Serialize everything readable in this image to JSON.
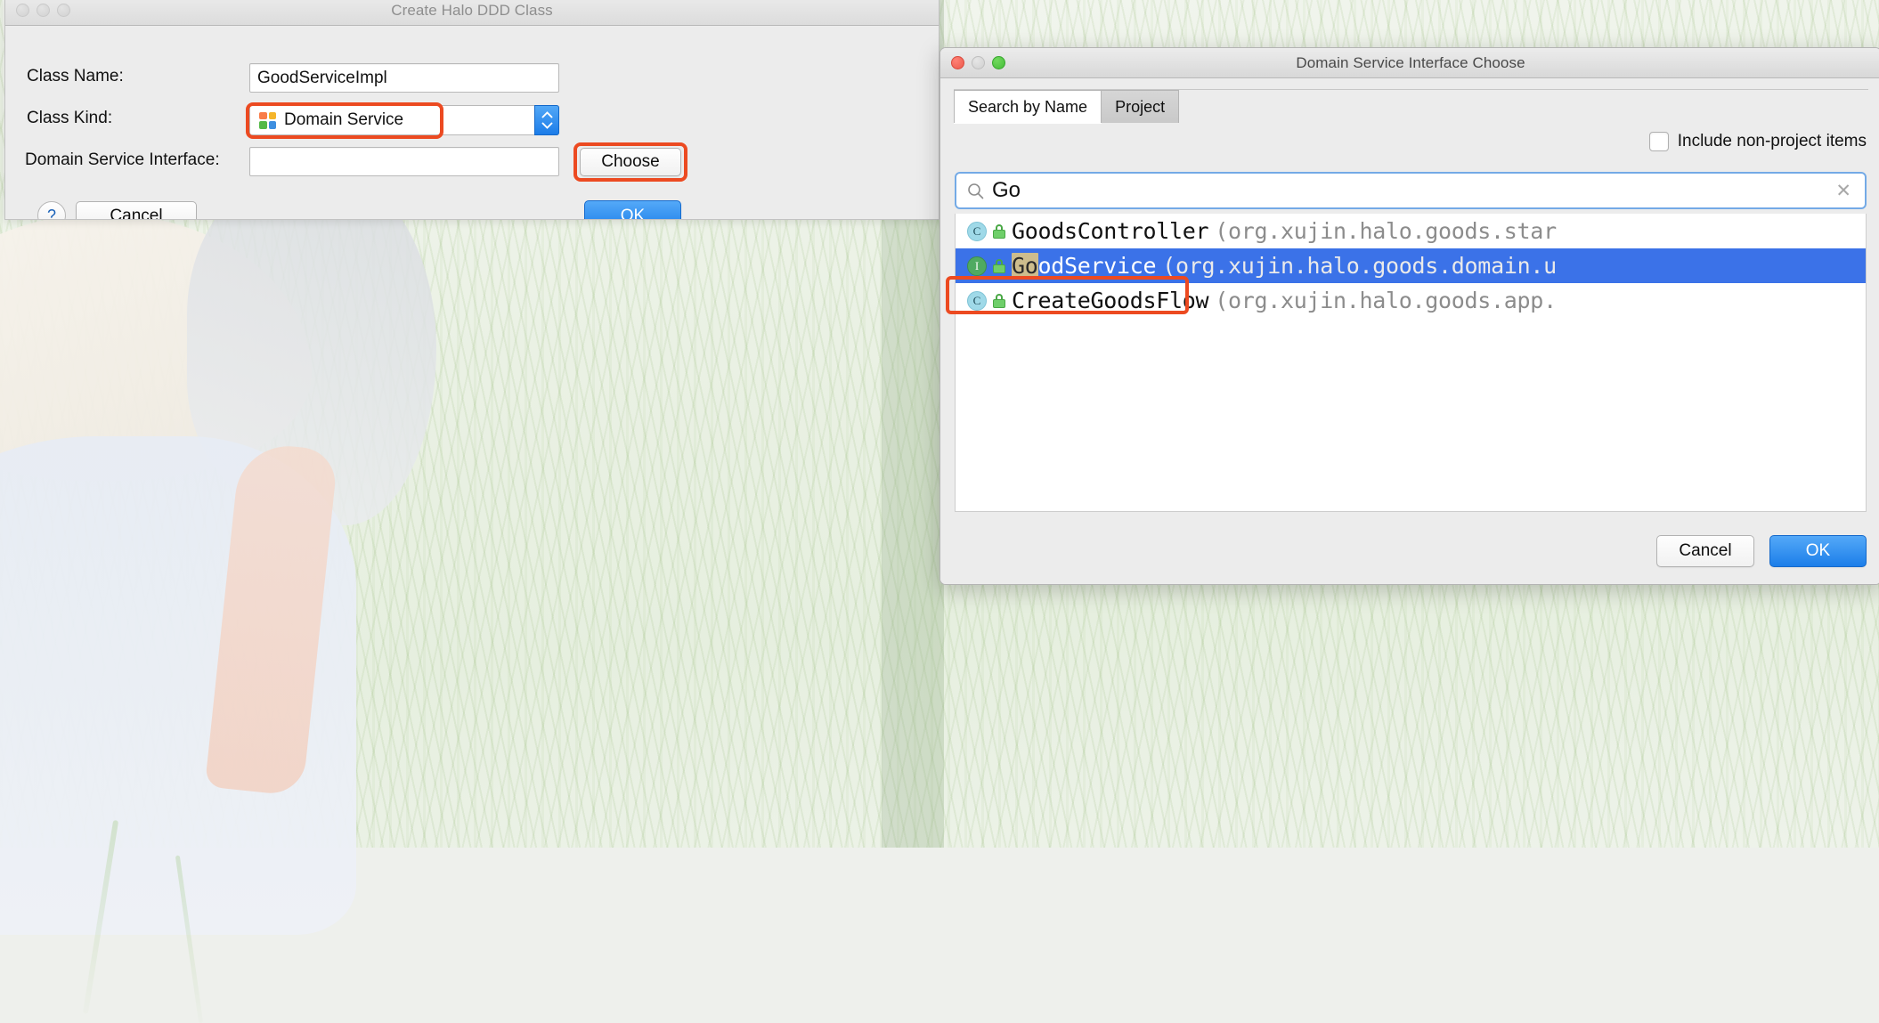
{
  "desktop": {
    "note": "blurred light background photo of a figure in grass"
  },
  "left_dialog": {
    "title": "Create Halo DDD Class",
    "traffic_lights": [
      "close-inactive",
      "minimize-inactive",
      "maximize-inactive"
    ],
    "fields": {
      "class_name_label": "Class   Name:",
      "class_name_value": "GoodServiceImpl",
      "class_name_placeholder": "",
      "class_kind_label": "Class   Kind:",
      "class_kind_value": "Domain Service",
      "class_kind_icon": "module-squares-icon",
      "domain_service_interface_label": "Domain Service Interface:",
      "domain_service_interface_value": "",
      "domain_service_interface_placeholder": ""
    },
    "buttons": {
      "choose": "Choose",
      "help": "?",
      "cancel": "Cancel",
      "ok": "OK"
    },
    "highlights": [
      "class-kind-combo",
      "choose-button"
    ]
  },
  "right_dialog": {
    "title": "Domain Service Interface Choose",
    "traffic_lights": [
      "close-red",
      "minimize-gray",
      "maximize-green"
    ],
    "tabs": [
      {
        "label": "Search by Name",
        "selected": true
      },
      {
        "label": "Project",
        "selected": false
      }
    ],
    "include_non_project": {
      "label": "Include non-project items",
      "checked": false
    },
    "search": {
      "icon": "search-icon",
      "value": "Go",
      "placeholder": "",
      "clear_icon": "clear-x-icon"
    },
    "results": [
      {
        "type_badge": "C",
        "type_kind": "class",
        "visibility_icon": "public-lock-icon",
        "name": "GoodsController",
        "match_prefix": "",
        "package": "(org.xujin.halo.goods.star",
        "selected": false
      },
      {
        "type_badge": "I",
        "type_kind": "interface",
        "visibility_icon": "public-lock-icon",
        "name": "GoodService",
        "match_prefix": "Go",
        "package": "(org.xujin.halo.goods.domain.u",
        "selected": true
      },
      {
        "type_badge": "C",
        "type_kind": "class",
        "visibility_icon": "public-lock-icon",
        "name": "CreateGoodsFlow",
        "match_prefix": "",
        "package": "(org.xujin.halo.goods.app.",
        "selected": false
      }
    ],
    "buttons": {
      "cancel": "Cancel",
      "ok": "OK"
    },
    "highlights": [
      "selected-result-row"
    ]
  },
  "colors": {
    "highlight_ring": "#ec4a21",
    "selection_blue": "#3b72e8",
    "match_highlight": "#cdbd8d",
    "primary_button": "#1c7ee9",
    "search_focus_border": "#74aae6",
    "interface_badge": "#4faa62",
    "class_badge": "#9fd9e8",
    "icon_orange": "#f97c48",
    "icon_yellow": "#f5b52a",
    "icon_green": "#54b948",
    "icon_blue": "#3e8fe0"
  }
}
